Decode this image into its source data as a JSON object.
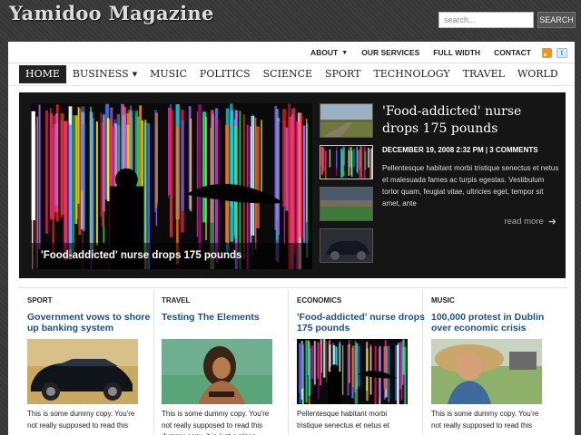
{
  "header": {
    "site_title": "Yamidoo Magazine",
    "search_placeholder": "search...",
    "search_button": "SEARCH"
  },
  "topnav": {
    "items": [
      "ABOUT",
      "OUR SERVICES",
      "FULL WIDTH",
      "CONTACT"
    ]
  },
  "mainnav": {
    "items": [
      "HOME",
      "BUSINESS",
      "MUSIC",
      "POLITICS",
      "SCIENCE",
      "SPORT",
      "TECHNOLOGY",
      "TRAVEL",
      "WORLD"
    ]
  },
  "feature": {
    "caption": "'Food-addicted' nurse drops 175 pounds",
    "title": "'Food-addicted' nurse drops 175 pounds",
    "meta": "DECEMBER 19, 2008 2:32 PM | 3 COMMENTS",
    "excerpt": "Pellentesque habitant morbi tristique senectus et netus et malesuada fames ac turpis egestas. Vestibulum tortor quam, feugiat vitae, ultricies eget, tempor sit amet, ante",
    "read_more": "read more"
  },
  "columns": [
    {
      "category": "SPORT",
      "title": "Government vows to shore up banking system",
      "text": "This is some dummy copy. You're not really supposed to read this"
    },
    {
      "category": "TRAVEL",
      "title": "Testing The Elements",
      "text": "This is some dummy copy. You're not really supposed to read this dummy copy, it is just a place holder"
    },
    {
      "category": "ECONOMICS",
      "title": "'Food-addicted' nurse drops 175 pounds",
      "text": "Pellentesque habitant morbi tristique senectus et netus et"
    },
    {
      "category": "MUSIC",
      "title": "100,000 protest in Dublin over economic crisis",
      "text": "This is some dummy copy. You're not really supposed to read this"
    }
  ],
  "colors": {
    "link_blue": "#1f4f86",
    "feature_bg": "#151515",
    "nav_active": "#222222"
  }
}
